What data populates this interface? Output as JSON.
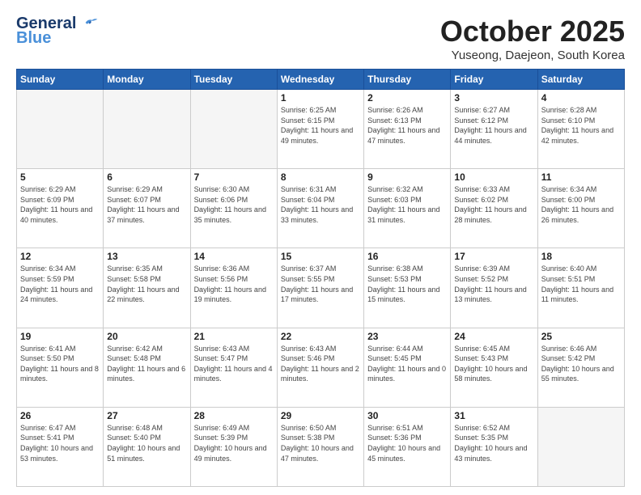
{
  "header": {
    "logo_line1": "General",
    "logo_line2": "Blue",
    "month_title": "October 2025",
    "location": "Yuseong, Daejeon, South Korea"
  },
  "days_of_week": [
    "Sunday",
    "Monday",
    "Tuesday",
    "Wednesday",
    "Thursday",
    "Friday",
    "Saturday"
  ],
  "weeks": [
    [
      {
        "day": "",
        "info": ""
      },
      {
        "day": "",
        "info": ""
      },
      {
        "day": "",
        "info": ""
      },
      {
        "day": "1",
        "info": "Sunrise: 6:25 AM\nSunset: 6:15 PM\nDaylight: 11 hours\nand 49 minutes."
      },
      {
        "day": "2",
        "info": "Sunrise: 6:26 AM\nSunset: 6:13 PM\nDaylight: 11 hours\nand 47 minutes."
      },
      {
        "day": "3",
        "info": "Sunrise: 6:27 AM\nSunset: 6:12 PM\nDaylight: 11 hours\nand 44 minutes."
      },
      {
        "day": "4",
        "info": "Sunrise: 6:28 AM\nSunset: 6:10 PM\nDaylight: 11 hours\nand 42 minutes."
      }
    ],
    [
      {
        "day": "5",
        "info": "Sunrise: 6:29 AM\nSunset: 6:09 PM\nDaylight: 11 hours\nand 40 minutes."
      },
      {
        "day": "6",
        "info": "Sunrise: 6:29 AM\nSunset: 6:07 PM\nDaylight: 11 hours\nand 37 minutes."
      },
      {
        "day": "7",
        "info": "Sunrise: 6:30 AM\nSunset: 6:06 PM\nDaylight: 11 hours\nand 35 minutes."
      },
      {
        "day": "8",
        "info": "Sunrise: 6:31 AM\nSunset: 6:04 PM\nDaylight: 11 hours\nand 33 minutes."
      },
      {
        "day": "9",
        "info": "Sunrise: 6:32 AM\nSunset: 6:03 PM\nDaylight: 11 hours\nand 31 minutes."
      },
      {
        "day": "10",
        "info": "Sunrise: 6:33 AM\nSunset: 6:02 PM\nDaylight: 11 hours\nand 28 minutes."
      },
      {
        "day": "11",
        "info": "Sunrise: 6:34 AM\nSunset: 6:00 PM\nDaylight: 11 hours\nand 26 minutes."
      }
    ],
    [
      {
        "day": "12",
        "info": "Sunrise: 6:34 AM\nSunset: 5:59 PM\nDaylight: 11 hours\nand 24 minutes."
      },
      {
        "day": "13",
        "info": "Sunrise: 6:35 AM\nSunset: 5:58 PM\nDaylight: 11 hours\nand 22 minutes."
      },
      {
        "day": "14",
        "info": "Sunrise: 6:36 AM\nSunset: 5:56 PM\nDaylight: 11 hours\nand 19 minutes."
      },
      {
        "day": "15",
        "info": "Sunrise: 6:37 AM\nSunset: 5:55 PM\nDaylight: 11 hours\nand 17 minutes."
      },
      {
        "day": "16",
        "info": "Sunrise: 6:38 AM\nSunset: 5:53 PM\nDaylight: 11 hours\nand 15 minutes."
      },
      {
        "day": "17",
        "info": "Sunrise: 6:39 AM\nSunset: 5:52 PM\nDaylight: 11 hours\nand 13 minutes."
      },
      {
        "day": "18",
        "info": "Sunrise: 6:40 AM\nSunset: 5:51 PM\nDaylight: 11 hours\nand 11 minutes."
      }
    ],
    [
      {
        "day": "19",
        "info": "Sunrise: 6:41 AM\nSunset: 5:50 PM\nDaylight: 11 hours\nand 8 minutes."
      },
      {
        "day": "20",
        "info": "Sunrise: 6:42 AM\nSunset: 5:48 PM\nDaylight: 11 hours\nand 6 minutes."
      },
      {
        "day": "21",
        "info": "Sunrise: 6:43 AM\nSunset: 5:47 PM\nDaylight: 11 hours\nand 4 minutes."
      },
      {
        "day": "22",
        "info": "Sunrise: 6:43 AM\nSunset: 5:46 PM\nDaylight: 11 hours\nand 2 minutes."
      },
      {
        "day": "23",
        "info": "Sunrise: 6:44 AM\nSunset: 5:45 PM\nDaylight: 11 hours\nand 0 minutes."
      },
      {
        "day": "24",
        "info": "Sunrise: 6:45 AM\nSunset: 5:43 PM\nDaylight: 10 hours\nand 58 minutes."
      },
      {
        "day": "25",
        "info": "Sunrise: 6:46 AM\nSunset: 5:42 PM\nDaylight: 10 hours\nand 55 minutes."
      }
    ],
    [
      {
        "day": "26",
        "info": "Sunrise: 6:47 AM\nSunset: 5:41 PM\nDaylight: 10 hours\nand 53 minutes."
      },
      {
        "day": "27",
        "info": "Sunrise: 6:48 AM\nSunset: 5:40 PM\nDaylight: 10 hours\nand 51 minutes."
      },
      {
        "day": "28",
        "info": "Sunrise: 6:49 AM\nSunset: 5:39 PM\nDaylight: 10 hours\nand 49 minutes."
      },
      {
        "day": "29",
        "info": "Sunrise: 6:50 AM\nSunset: 5:38 PM\nDaylight: 10 hours\nand 47 minutes."
      },
      {
        "day": "30",
        "info": "Sunrise: 6:51 AM\nSunset: 5:36 PM\nDaylight: 10 hours\nand 45 minutes."
      },
      {
        "day": "31",
        "info": "Sunrise: 6:52 AM\nSunset: 5:35 PM\nDaylight: 10 hours\nand 43 minutes."
      },
      {
        "day": "",
        "info": ""
      }
    ]
  ]
}
